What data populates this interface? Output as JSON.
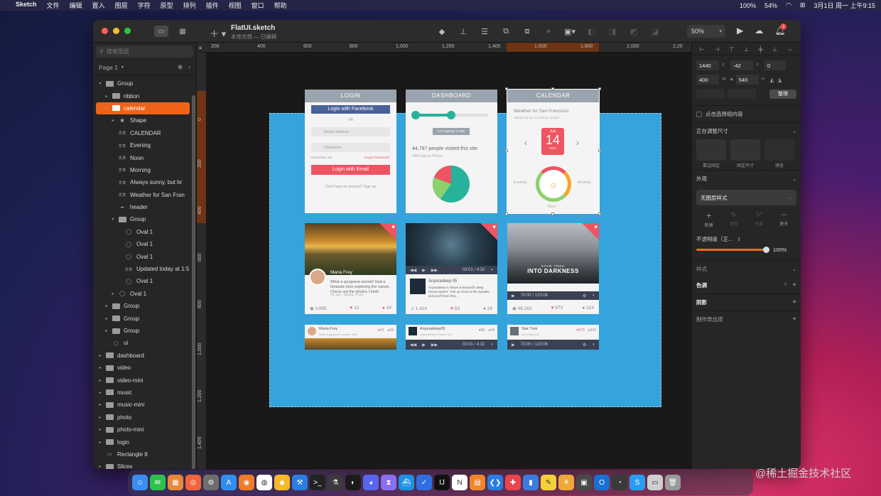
{
  "menubar": {
    "items": [
      "Sketch",
      "文件",
      "编辑",
      "置入",
      "图层",
      "字符",
      "原型",
      "排列",
      "插件",
      "视图",
      "窗口",
      "帮助"
    ],
    "battery_pct": "100%",
    "battery2": "54%",
    "clock": "3月1日 周一 上午9:15"
  },
  "window": {
    "title": "FlatUI.sketch",
    "subtitle": "本地文档 — 已编辑",
    "zoom": "50%",
    "notif_count": "1"
  },
  "layers": {
    "search_placeholder": "搜索图层",
    "page_label": "Page 1",
    "items": [
      {
        "label": "Group",
        "indent": 0,
        "type": "folder",
        "disc": "open"
      },
      {
        "label": "ribbon",
        "indent": 1,
        "type": "folder",
        "disc": "closed"
      },
      {
        "label": "calendar",
        "indent": 1,
        "type": "folder",
        "disc": "open",
        "selected": true
      },
      {
        "label": "Shape",
        "indent": 2,
        "type": "shape",
        "disc": "closed"
      },
      {
        "label": "CALENDAR",
        "indent": 2,
        "type": "text"
      },
      {
        "label": "Evening",
        "indent": 2,
        "type": "text"
      },
      {
        "label": "Noon",
        "indent": 2,
        "type": "text"
      },
      {
        "label": "Morning",
        "indent": 2,
        "type": "text"
      },
      {
        "label": "Always sunny, but br",
        "indent": 2,
        "type": "text"
      },
      {
        "label": "Weather for San Fran",
        "indent": 2,
        "type": "text"
      },
      {
        "label": "header",
        "indent": 2,
        "type": "line"
      },
      {
        "label": "Group",
        "indent": 2,
        "type": "folder",
        "disc": "open"
      },
      {
        "label": "Oval 1",
        "indent": 3,
        "type": "oval"
      },
      {
        "label": "Oval 1",
        "indent": 3,
        "type": "oval"
      },
      {
        "label": "Oval 1",
        "indent": 3,
        "type": "oval"
      },
      {
        "label": "Updated today at 1:5",
        "indent": 3,
        "type": "text"
      },
      {
        "label": "Oval 1",
        "indent": 3,
        "type": "oval"
      },
      {
        "label": "Oval 1",
        "indent": 2,
        "type": "oval",
        "disc": "closed"
      },
      {
        "label": "Group",
        "indent": 1,
        "type": "folder",
        "disc": "closed"
      },
      {
        "label": "Group",
        "indent": 1,
        "type": "folder",
        "disc": "closed"
      },
      {
        "label": "Group",
        "indent": 1,
        "type": "folder",
        "disc": "closed"
      },
      {
        "label": "ui",
        "indent": 1,
        "type": "image"
      },
      {
        "label": "dashboard",
        "indent": 0,
        "type": "folder",
        "disc": "closed"
      },
      {
        "label": "video",
        "indent": 0,
        "type": "folder",
        "disc": "closed"
      },
      {
        "label": "video-mini",
        "indent": 0,
        "type": "folder",
        "disc": "closed"
      },
      {
        "label": "music",
        "indent": 0,
        "type": "folder",
        "disc": "closed"
      },
      {
        "label": "music-mini",
        "indent": 0,
        "type": "folder",
        "disc": "closed"
      },
      {
        "label": "photo",
        "indent": 0,
        "type": "folder",
        "disc": "closed"
      },
      {
        "label": "photo-mini",
        "indent": 0,
        "type": "folder",
        "disc": "closed"
      },
      {
        "label": "login",
        "indent": 0,
        "type": "folder",
        "disc": "closed"
      },
      {
        "label": "Rectangle 8",
        "indent": 0,
        "type": "rect"
      },
      {
        "label": "Slices",
        "indent": 0,
        "type": "folder",
        "disc": "closed"
      }
    ]
  },
  "ruler": {
    "top": [
      "200",
      "400",
      "600",
      "800",
      "1,000",
      "1,200",
      "1,400",
      "1,600",
      "1,800",
      "2,000",
      "2,20"
    ],
    "left": [
      "0",
      "200",
      "400",
      "600",
      "800",
      "1,000",
      "1,200",
      "1,400",
      "1,600"
    ]
  },
  "cards": {
    "login": {
      "title": "LOGIN",
      "fb": "Login with Facebook",
      "or": "OR",
      "email": "Email address",
      "password": "Password",
      "remember": "Remember Me",
      "forgot": "Forgot Password?",
      "login_email": "Login with Email",
      "signup": "Don't have an account? Sign up"
    },
    "dashboard": {
      "title": "DASHBOARD",
      "tooltip": "476 signups in 848",
      "visits": "44,787 people visited this site",
      "sub": "24% had an iPhone"
    },
    "calendar": {
      "title": "CALENDAR",
      "weather": "Weather for San Francisco",
      "sunny": "Always sunny, but bring a jacket",
      "month": "July",
      "day": "14",
      "year": "2014",
      "evening": "Evening",
      "morning": "Morning",
      "noon": "Noon"
    },
    "photo": {
      "name": "Maria Frey",
      "text": "What a gorgeous sunset! Had a fantastic time exploring the nature. Check out the photos I took!",
      "meta": "3m ago · Beijing, China",
      "views": "3,885",
      "likes": "12",
      "comments": "34"
    },
    "music": {
      "time": "03:01 / 4:32",
      "artist": "Anjunadeep 05",
      "desc": "Anjunadeep is Above & Beyond's deep house imprint. \"Get up close to the speaker and you'll hear that...",
      "plays": "1,414",
      "likes": "83",
      "comments": "24"
    },
    "video": {
      "movie1": "STAR TREK",
      "movie2": "INTO DARKNESS",
      "time": "70:00 / 123:06",
      "views": "48,163",
      "likes": "973",
      "comments": "324"
    },
    "mini_photo": {
      "name": "Maria Frey",
      "text": "What a gorgeous sunset! Had",
      "likes": "12",
      "comments": "34"
    },
    "mini_music": {
      "name": "Anjunadeep05",
      "text": "Anjunadeep is Above & B",
      "likes": "83",
      "comments": "24",
      "time": "03:01 / 4:32"
    },
    "mini_video": {
      "name": "Star Trek",
      "text": "Into Darkness",
      "likes": "973",
      "comments": "324",
      "time": "70:00 / 123:06"
    }
  },
  "inspector": {
    "x": "1440",
    "y": "-42",
    "r": "0",
    "w": "400",
    "h": "540",
    "x_lbl": "X",
    "y_lbl": "Y",
    "w_lbl": "W",
    "h_lbl": "H",
    "organize": "整理",
    "click_select": "点击选择组内容",
    "resizing": "正在调整尺寸",
    "resize_opts": [
      "靠边固定",
      "固定尺寸",
      "预览"
    ],
    "appearance": "外观",
    "no_style": "无图层样式",
    "actions": [
      "新建",
      "更新",
      "分离",
      "更多"
    ],
    "opacity_label": "不透明度（正...",
    "opacity": 1.0,
    "opacity_text": "100%",
    "style": "样式",
    "tint": "色调",
    "shadow": "阴影",
    "export": "制作导出项"
  },
  "dock": {
    "icons": [
      "finder-icon",
      "wechat-icon",
      "launchpad-icon",
      "safari-icon",
      "settings-icon",
      "appstore-icon",
      "firefox-icon",
      "chrome-icon",
      "sketch-icon",
      "xcode-icon",
      "terminal-icon",
      "flask-icon",
      "github-icon",
      "discord-icon",
      "nodes-icon",
      "docker-icon",
      "check-icon",
      "intellij-icon",
      "notion-icon",
      "books-icon",
      "vscode-icon",
      "pocket-icon",
      "bookmark-icon",
      "notes-icon",
      "butterfly-icon",
      "monitor-icon",
      "outlook-icon",
      "speedtest-icon",
      "sequel-icon",
      "preview-icon",
      "trash-icon"
    ],
    "terminal_badge": "35H",
    "settings_badge": "1"
  },
  "watermark": "@稀土掘金技术社区"
}
